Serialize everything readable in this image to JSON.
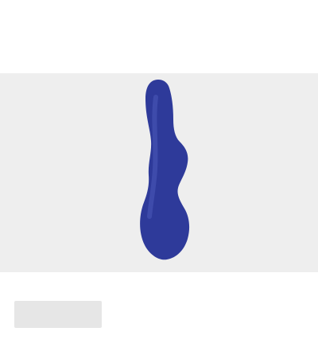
{
  "header": {
    "brand": "",
    "title": ""
  },
  "product": {
    "image_icon": "product-image",
    "image_color": "#2e3a9a",
    "caption": ""
  },
  "footer": {
    "price_label": "",
    "shipping_text": ""
  }
}
